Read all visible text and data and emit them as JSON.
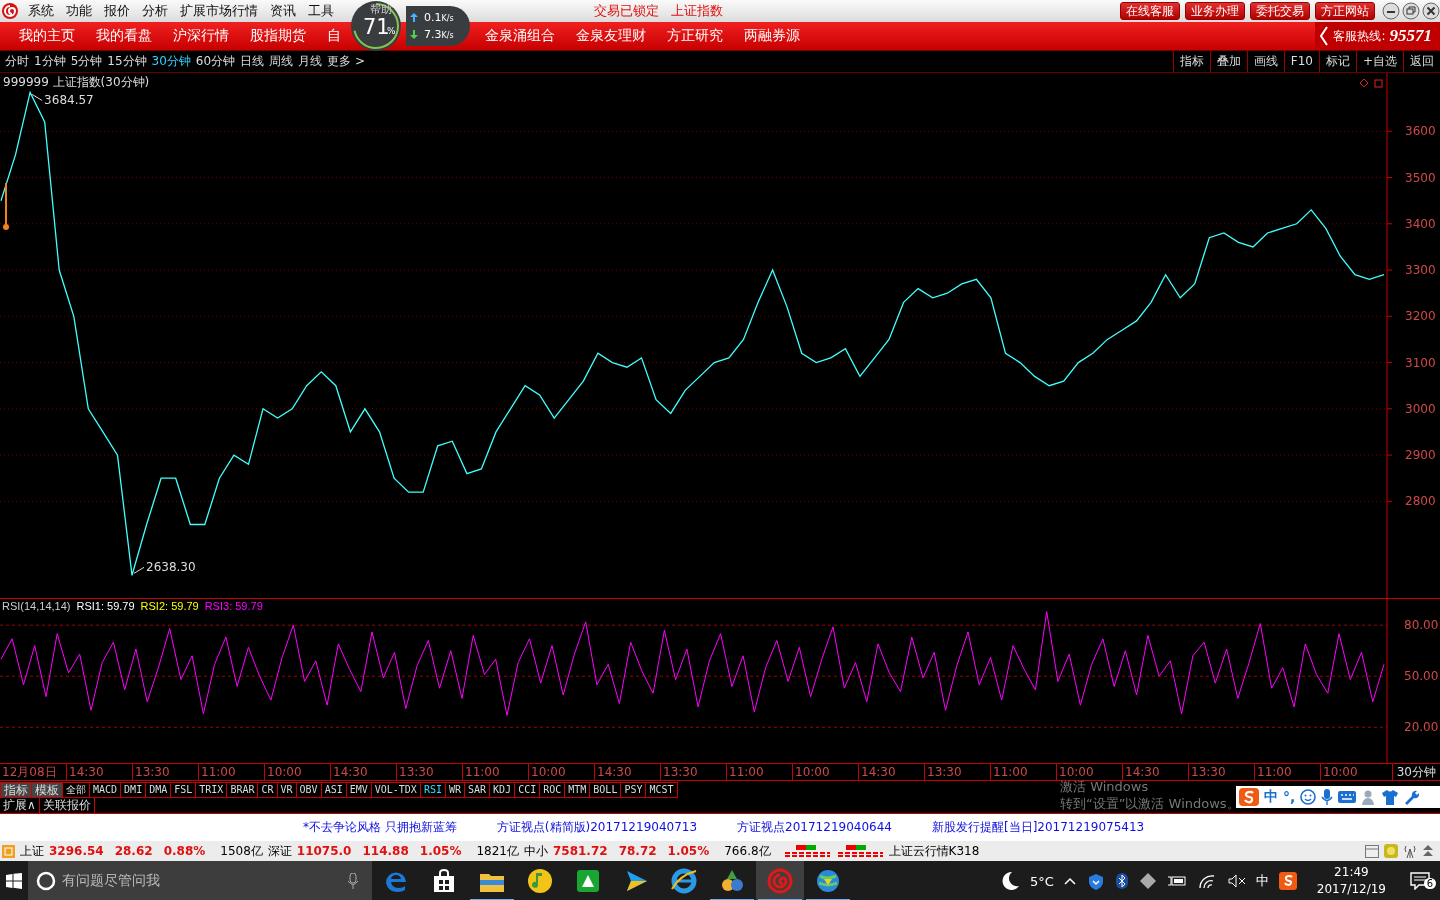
{
  "title_bar": {
    "menus": [
      "系统",
      "功能",
      "报价",
      "分析",
      "扩展市场行情",
      "资讯",
      "工具"
    ],
    "status_text": [
      "交易已锁定",
      "上证指数"
    ],
    "buttons": [
      "在线客服",
      "业务办理",
      "委托交易",
      "方正网站"
    ]
  },
  "speed_widget": {
    "label": "帮助",
    "percent": "71",
    "percent_sign": "%",
    "upload": "0.1",
    "upload_unit": "K/s",
    "download": "7.3",
    "download_unit": "K/s"
  },
  "nav": {
    "items": [
      "我的主页",
      "我的看盘",
      "沪深行情",
      "股指期货",
      "自",
      "金泉涌组合",
      "金泉友理财",
      "方正研究",
      "两融券源"
    ],
    "hotline_label": "客服热线:",
    "hotline": "95571"
  },
  "periods": [
    {
      "label": "分时",
      "selected": false
    },
    {
      "label": "1分钟",
      "selected": false
    },
    {
      "label": "5分钟",
      "selected": false
    },
    {
      "label": "15分钟",
      "selected": false
    },
    {
      "label": "30分钟",
      "selected": true
    },
    {
      "label": "60分钟",
      "selected": false
    },
    {
      "label": "日线",
      "selected": false
    },
    {
      "label": "周线",
      "selected": false
    },
    {
      "label": "月线",
      "selected": false
    },
    {
      "label": "更多 >",
      "selected": false
    }
  ],
  "tools": [
    "指标",
    "叠加",
    "画线",
    "F10",
    "标记",
    "+自选",
    "返回"
  ],
  "chart": {
    "title": "999999 上证指数(30分钟)",
    "chart_data": {
      "type": "line",
      "grid": true,
      "ylim": [
        2591,
        3726
      ],
      "yticks": [
        2800,
        2900,
        3000,
        3100,
        3200,
        3300,
        3400,
        3500,
        3600
      ],
      "series": [
        {
          "color": "#40ffff",
          "values": [
            3450,
            3550,
            3684,
            3620,
            3300,
            3200,
            3000,
            2950,
            2900,
            2640,
            2750,
            2850,
            2850,
            2750,
            2750,
            2850,
            2900,
            2880,
            3000,
            2980,
            3000,
            3050,
            3080,
            3050,
            2950,
            3000,
            2950,
            2850,
            2820,
            2820,
            2920,
            2930,
            2860,
            2870,
            2950,
            3000,
            3050,
            3030,
            2980,
            3020,
            3060,
            3120,
            3100,
            3090,
            3110,
            3020,
            2990,
            3040,
            3070,
            3100,
            3110,
            3150,
            3230,
            3300,
            3220,
            3120,
            3100,
            3110,
            3130,
            3070,
            3110,
            3150,
            3230,
            3260,
            3240,
            3250,
            3270,
            3280,
            3240,
            3120,
            3100,
            3070,
            3050,
            3060,
            3100,
            3120,
            3150,
            3170,
            3190,
            3230,
            3290,
            3240,
            3270,
            3370,
            3380,
            3360,
            3350,
            3380,
            3390,
            3400,
            3430,
            3390,
            3330,
            3290,
            3280,
            3290
          ]
        }
      ],
      "annotations": [
        "3684.57",
        "2638.30"
      ]
    }
  },
  "rsi": {
    "params": "RSI(14,14,14)",
    "readings": [
      {
        "label": "RSI1: 59.79",
        "color": "#ffffff"
      },
      {
        "label": "RSI2: 59.79",
        "color": "#ffff00"
      },
      {
        "label": "RSI3: 59.79",
        "color": "#ff00ff"
      }
    ],
    "chart_data": {
      "type": "line",
      "grid": true,
      "ylim": [
        -1,
        96
      ],
      "yticks": [
        {
          "value": 20,
          "label": "20.00"
        },
        {
          "value": 50,
          "label": "50.00"
        },
        {
          "value": 80,
          "label": "80.00"
        }
      ],
      "series": [
        {
          "color": "#ff00ff",
          "values": [
            60,
            72,
            45,
            68,
            38,
            75,
            52,
            63,
            30,
            58,
            70,
            42,
            66,
            35,
            55,
            78,
            48,
            62,
            28,
            57,
            73,
            44,
            67,
            50,
            36,
            61,
            80,
            47,
            59,
            33,
            69,
            54,
            41,
            76,
            49,
            64,
            31,
            56,
            71,
            43,
            65,
            37,
            74,
            51,
            60,
            27,
            58,
            72,
            46,
            68,
            39,
            63,
            82,
            45,
            57,
            34,
            70,
            53,
            40,
            77,
            48,
            66,
            32,
            59,
            75,
            44,
            62,
            29,
            55,
            71,
            47,
            67,
            38,
            60,
            79,
            43,
            58,
            35,
            69,
            52,
            41,
            73,
            49,
            64,
            30,
            56,
            76,
            45,
            61,
            36,
            68,
            54,
            42,
            88,
            47,
            63,
            33,
            57,
            72,
            44,
            65,
            39,
            74,
            50,
            59,
            28,
            62,
            70,
            46,
            66,
            37,
            58,
            81,
            43,
            55,
            32,
            69,
            51,
            40,
            75,
            48,
            64,
            35,
            57
          ]
        }
      ]
    }
  },
  "time_axis": {
    "labels": [
      "12月08日",
      "14:30",
      "13:30",
      "11:00",
      "10:00",
      "14:30",
      "13:30",
      "11:00",
      "10:00",
      "14:30",
      "13:30",
      "11:00",
      "10:00",
      "14:30",
      "13:30",
      "11:00",
      "10:00",
      "14:30",
      "13:30",
      "11:00",
      "10:00"
    ],
    "period": "30分钟"
  },
  "indicator_tabs": [
    {
      "label": "指标",
      "kind": "button",
      "selected": false
    },
    {
      "label": "模板",
      "kind": "button",
      "selected": false
    },
    {
      "label": "全部",
      "kind": "tab",
      "selected": false
    },
    {
      "label": "MACD",
      "kind": "tab",
      "selected": false
    },
    {
      "label": "DMI",
      "kind": "tab",
      "selected": false
    },
    {
      "label": "DMA",
      "kind": "tab",
      "selected": false
    },
    {
      "label": "FSL",
      "kind": "tab",
      "selected": false
    },
    {
      "label": "TRIX",
      "kind": "tab",
      "selected": false
    },
    {
      "label": "BRAR",
      "kind": "tab",
      "selected": false
    },
    {
      "label": "CR",
      "kind": "tab",
      "selected": false
    },
    {
      "label": "VR",
      "kind": "tab",
      "selected": false
    },
    {
      "label": "OBV",
      "kind": "tab",
      "selected": false
    },
    {
      "label": "ASI",
      "kind": "tab",
      "selected": false
    },
    {
      "label": "EMV",
      "kind": "tab",
      "selected": false
    },
    {
      "label": "VOL-TDX",
      "kind": "tab",
      "selected": false
    },
    {
      "label": "RSI",
      "kind": "tab",
      "selected": true
    },
    {
      "label": "WR",
      "kind": "tab",
      "selected": false
    },
    {
      "label": "SAR",
      "kind": "tab",
      "selected": false
    },
    {
      "label": "KDJ",
      "kind": "tab",
      "selected": false
    },
    {
      "label": "CCI",
      "kind": "tab",
      "selected": false
    },
    {
      "label": "ROC",
      "kind": "tab",
      "selected": false
    },
    {
      "label": "MTM",
      "kind": "tab",
      "selected": false
    },
    {
      "label": "BOLL",
      "kind": "tab",
      "selected": false
    },
    {
      "label": "PSY",
      "kind": "tab",
      "selected": false
    },
    {
      "label": "MCST",
      "kind": "tab",
      "selected": false
    }
  ],
  "extra_tabs": [
    "扩展∧",
    "关联报价"
  ],
  "activation": [
    "激活 Windows",
    "转到“设置”以激活 Windows。"
  ],
  "ime_toolbar": {
    "mode": "中",
    "punct": "°,"
  },
  "news": [
    "*不去争论风格 只拥抱新蓝筹",
    "方证视点(精简版)20171219040713",
    "方证视点20171219040644",
    "新股发行提醒[当日]20171219075413"
  ],
  "status_bar": {
    "indices": [
      {
        "name": "上证",
        "value": "3296.54",
        "change": "28.62",
        "percent": "0.88%",
        "volume": "1508亿"
      },
      {
        "name": "深证",
        "value": "11075.0",
        "change": "114.88",
        "percent": "1.05%",
        "volume": "1821亿"
      },
      {
        "name": "中小",
        "value": "7581.72",
        "change": "78.72",
        "percent": "1.05%",
        "volume": "766.8亿"
      }
    ],
    "feed": "上证云行情K318"
  },
  "taskbar": {
    "search_placeholder": "有问题尽管问我",
    "apps": [
      {
        "kind": "edge",
        "running": false,
        "selected": false
      },
      {
        "kind": "store",
        "running": false,
        "selected": false
      },
      {
        "kind": "explorer",
        "running": true,
        "selected": false
      },
      {
        "kind": "music",
        "running": false,
        "selected": false
      },
      {
        "kind": "green",
        "running": false,
        "selected": false
      },
      {
        "kind": "video",
        "running": false,
        "selected": false
      },
      {
        "kind": "ie",
        "running": false,
        "selected": false
      },
      {
        "kind": "trader",
        "running": true,
        "selected": false
      },
      {
        "kind": "swirl",
        "running": true,
        "selected": true
      },
      {
        "kind": "globe",
        "running": true,
        "selected": false
      }
    ],
    "weather": "5°C",
    "ime": "中",
    "time": "21:49",
    "date": "2017/12/19",
    "notifications": "6"
  }
}
